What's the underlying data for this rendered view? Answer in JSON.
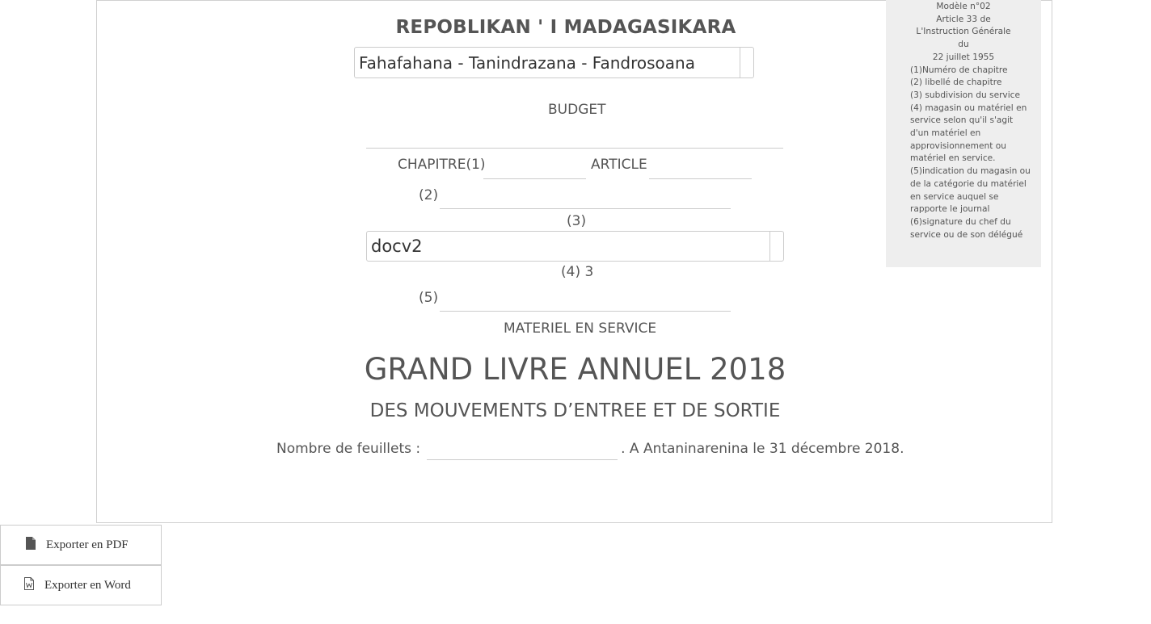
{
  "header": {
    "republic": "REPOBLIKAN ' I MADAGASIKARA",
    "motto_select_value": "Fahafahana - Tanindrazana - Fandrosoana"
  },
  "form": {
    "budget_label": "BUDGET",
    "chapitre_label": "CHAPITRE(1)",
    "article_label": "ARTICLE",
    "label_2": "(2)",
    "label_3": "(3)",
    "doc_select_value": "docv2",
    "label_4": "(4) 3",
    "label_5": "(5)",
    "materiel_label": "MATERIEL EN SERVICE"
  },
  "titles": {
    "main": "GRAND LIVRE ANNUEL 2018",
    "sub": "DES MOUVEMENTS D’ENTREE ET DE SORTIE"
  },
  "footer": {
    "feuillets_label": "Nombre de feuillets  :",
    "place_date": ". A Antaninarenina le 31 décembre 2018."
  },
  "notes": {
    "centered": [
      "Modèle n°02",
      "Article 33 de",
      "L'Instruction Générale",
      "du",
      "22 juillet 1955"
    ],
    "lines": [
      "(1)Numéro de chapitre",
      "(2) libellé de chapitre",
      "(3) subdivision du service",
      "(4) magasin ou matériel en service selon qu'il s'agit d'un matériel en approvisionnement ou matériel en service.",
      "(5)indication du magasin ou de la catégorie du matériel en service auquel se rapporte le journal",
      "(6)signature du chef du service ou de son délégué"
    ]
  },
  "actions": {
    "pdf_label": "Exporter en PDF",
    "word_label": "Exporter en Word"
  },
  "icons": {
    "pdf": "file-icon",
    "word": "word-file-icon"
  }
}
